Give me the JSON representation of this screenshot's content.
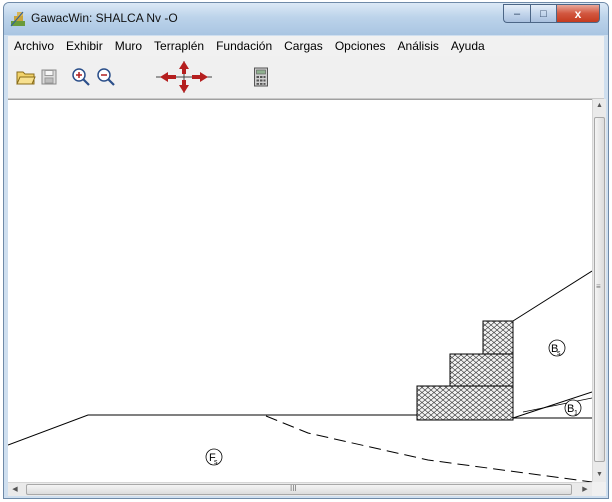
{
  "window": {
    "title": "GawacWin: SHALCA Nv -O",
    "controls": {
      "minimize_glyph": "–",
      "maximize_glyph": "□",
      "close_glyph": "x"
    }
  },
  "menubar": {
    "items": [
      "Archivo",
      "Exhibir",
      "Muro",
      "Terraplén",
      "Fundación",
      "Cargas",
      "Opciones",
      "Análisis",
      "Ayuda"
    ]
  },
  "toolbar": {
    "buttons": [
      "open-folder-icon",
      "save-disk-icon",
      "zoom-in-icon",
      "zoom-out-icon",
      "pan-arrows-icon",
      "calculator-icon"
    ]
  },
  "drawing": {
    "zone_labels": {
      "foundation": {
        "main": "F",
        "sub": "s"
      },
      "backfill": {
        "main": "B",
        "sub": "s"
      },
      "backfill_lower": {
        "main": "B",
        "sub": "1"
      }
    },
    "line_color": "#000000",
    "gabion_fill": "#e8e8e8"
  },
  "scrollbars": {
    "hscroll_grip": "III",
    "vscroll_grip": "≡",
    "up_arrow": "▲",
    "down_arrow": "▼",
    "left_arrow": "◀",
    "right_arrow": "▶"
  }
}
